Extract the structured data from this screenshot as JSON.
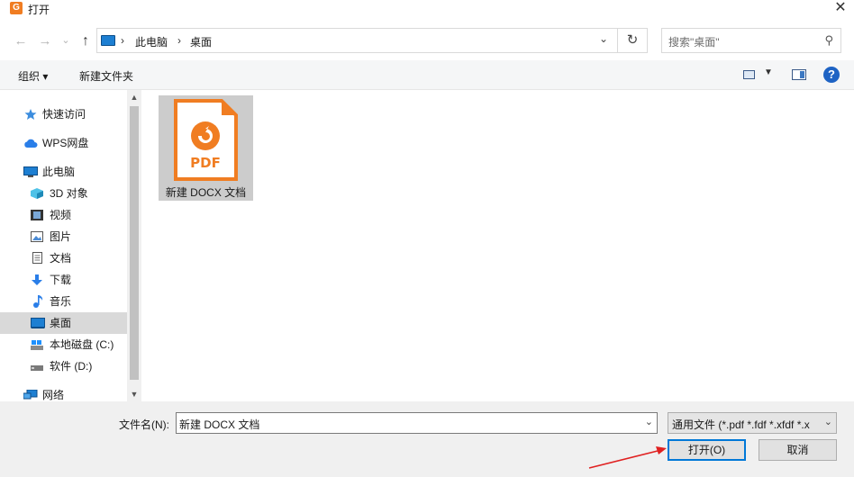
{
  "window": {
    "title": "打开",
    "app_icon_letter": "G",
    "close_glyph": "✕"
  },
  "nav": {
    "back_glyph": "←",
    "forward_glyph": "→",
    "recent_glyph": "⌄",
    "up_glyph": "↑",
    "refresh_glyph": "↻"
  },
  "address": {
    "crumbs": [
      "此电脑",
      "桌面"
    ],
    "separator": "›",
    "dropdown_glyph": "⌄"
  },
  "search": {
    "placeholder": "搜索\"桌面\"",
    "icon_glyph": "⚲"
  },
  "toolbar": {
    "organize_label": "组织 ▾",
    "new_folder_label": "新建文件夹",
    "view_chevron": "▼",
    "help_glyph": "?"
  },
  "sidebar": {
    "items": [
      {
        "label": "快速访问",
        "icon": "star-icon"
      },
      {
        "label": "WPS网盘",
        "icon": "cloud-icon"
      },
      {
        "label": "此电脑",
        "icon": "computer-icon"
      },
      {
        "label": "3D 对象",
        "icon": "cube-icon"
      },
      {
        "label": "视频",
        "icon": "film-icon"
      },
      {
        "label": "图片",
        "icon": "picture-icon"
      },
      {
        "label": "文档",
        "icon": "document-icon"
      },
      {
        "label": "下载",
        "icon": "download-icon"
      },
      {
        "label": "音乐",
        "icon": "music-icon"
      },
      {
        "label": "桌面",
        "icon": "desktop-icon",
        "selected": true
      },
      {
        "label": "本地磁盘 (C:)",
        "icon": "drive-icon"
      },
      {
        "label": "软件 (D:)",
        "icon": "drive-icon"
      },
      {
        "label": "网络",
        "icon": "network-icon"
      }
    ],
    "scroll_up": "▲",
    "scroll_down": "▼"
  },
  "files": [
    {
      "name": "新建 DOCX 文档",
      "badge": "PDF",
      "selected": true
    }
  ],
  "bottom": {
    "filename_label": "文件名(N):",
    "filename_value": "新建 DOCX 文档",
    "dropdown_glyph": "⌄",
    "filter_value": "通用文件 (*.pdf *.fdf *.xfdf *.x",
    "open_label": "打开(O)",
    "cancel_label": "取消"
  },
  "colors": {
    "accent": "#0078d7",
    "pdf_orange": "#f07d22",
    "selection": "#d9d9d9",
    "annotation_red": "#e02020"
  }
}
